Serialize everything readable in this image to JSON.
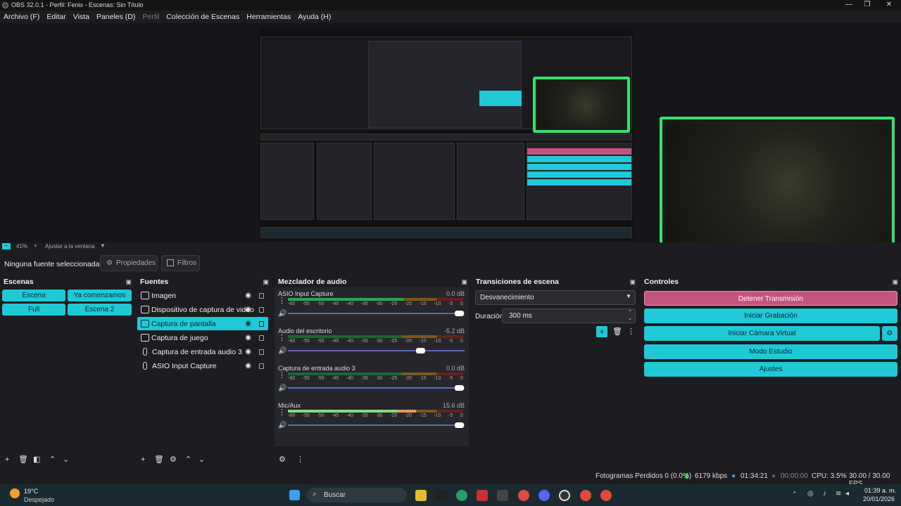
{
  "window": {
    "title": "OBS 32.0.1 - Perfil: Fenix - Escenas: Sin Título"
  },
  "menu": [
    "Archivo (F)",
    "Editar",
    "Vista",
    "Paneles (D)",
    "Perfil",
    "Colección de Escenas",
    "Herramientas",
    "Ayuda (H)"
  ],
  "zoom": {
    "level": "41%",
    "fit_label": "Ajustar a la ventana"
  },
  "source_toolbar": {
    "selected": "Ninguna fuente seleccionada",
    "properties": "Propiedades",
    "filters": "Filtros"
  },
  "scenes": {
    "header": "Escenas",
    "items": [
      "Escena",
      "Ya comenzamos",
      "Full",
      "Escena 2"
    ]
  },
  "sources": {
    "header": "Fuentes",
    "items": [
      "Imagen",
      "Dispositivo de captura de video",
      "Captura de pantalla",
      "Captura de juego",
      "Captura de entrada audio 3",
      "ASIO Input Capture"
    ]
  },
  "mixer": {
    "header": "Mezclador de audio",
    "scale": [
      "-60",
      "-55",
      "-50",
      "-45",
      "-40",
      "-35",
      "-30",
      "-25",
      "-20",
      "-15",
      "-10",
      "-5",
      "0"
    ],
    "channels": [
      {
        "name": "ASIO Input Capture",
        "db": "0.0 dB"
      },
      {
        "name": "Audio del escritorio",
        "db": "-5.2 dB"
      },
      {
        "name": "Captura de entrada audio 3",
        "db": "0.0 dB"
      },
      {
        "name": "Mic/Aux",
        "db": "15.6 dB"
      }
    ]
  },
  "transitions": {
    "header": "Transiciones de escena",
    "selected": "Desvanecimiento",
    "duration_label": "Duración",
    "duration_value": "300 ms"
  },
  "controls": {
    "header": "Controles",
    "stop_stream": "Detener Transmisión",
    "start_recording": "Iniciar Grabación",
    "start_virtual_cam": "Iniciar Cámara Virtual",
    "studio_mode": "Modo Estudio",
    "settings": "Ajustes"
  },
  "status": {
    "dropped": "Fotogramas Perdidos 0 (0.0%)",
    "bitrate": "6179 kbps",
    "stream_time": "01:34:21",
    "rec_time": "00:00:00",
    "cpu": "CPU: 3.5%",
    "fps": "30.00 / 30.00 FPS"
  },
  "taskbar": {
    "weather_temp": "19°C",
    "weather_desc": "Despejado",
    "search": "Buscar",
    "time": "01:39 a. m.",
    "date": "20/01/2026"
  },
  "colors": {
    "accent": "#1fc9d6",
    "stop": "#c2547f",
    "frame": "#37e06a"
  }
}
